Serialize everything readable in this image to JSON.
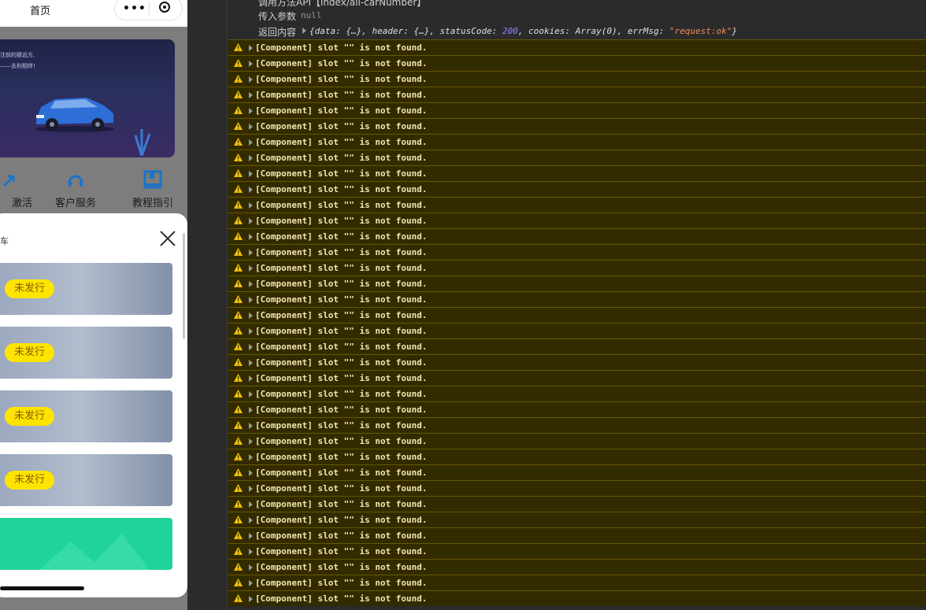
{
  "simulator": {
    "nav_title": "首页",
    "capsule_more": "•••",
    "banner_lines": [
      "注前的那远方,",
      "——去利相伴!"
    ],
    "quick_actions": [
      {
        "label": "激活",
        "icon": "activate-icon"
      },
      {
        "label": "客户服务",
        "icon": "headset-icon"
      },
      {
        "label": "教程指引",
        "icon": "book-icon"
      }
    ],
    "sheet_title": "车",
    "cards": [
      {
        "status": "未发行"
      },
      {
        "status": "未发行"
      },
      {
        "status": "未发行"
      },
      {
        "status": "未发行"
      }
    ],
    "colors": {
      "badge": "#ffe400",
      "green_card": "#1fd39a"
    }
  },
  "console": {
    "request": {
      "method_line": "调用方法API【index/all-carNumber】",
      "params_label": "传入参数",
      "params_value": "null",
      "return_label": "返回内容",
      "return_prefix": "{data: {…}, header: {…}, statusCode: ",
      "status_code": "200",
      "return_middle": ", cookies: Array(0), errMsg: ",
      "err_msg": "\"request:ok\"",
      "return_suffix": "}"
    },
    "warning_message": "[Component] slot \"\" is not found.",
    "warning_count": 36,
    "colors": {
      "warning_bg": "#332b00",
      "warning_border": "#665500",
      "warning_text": "#f2e6b0"
    }
  }
}
